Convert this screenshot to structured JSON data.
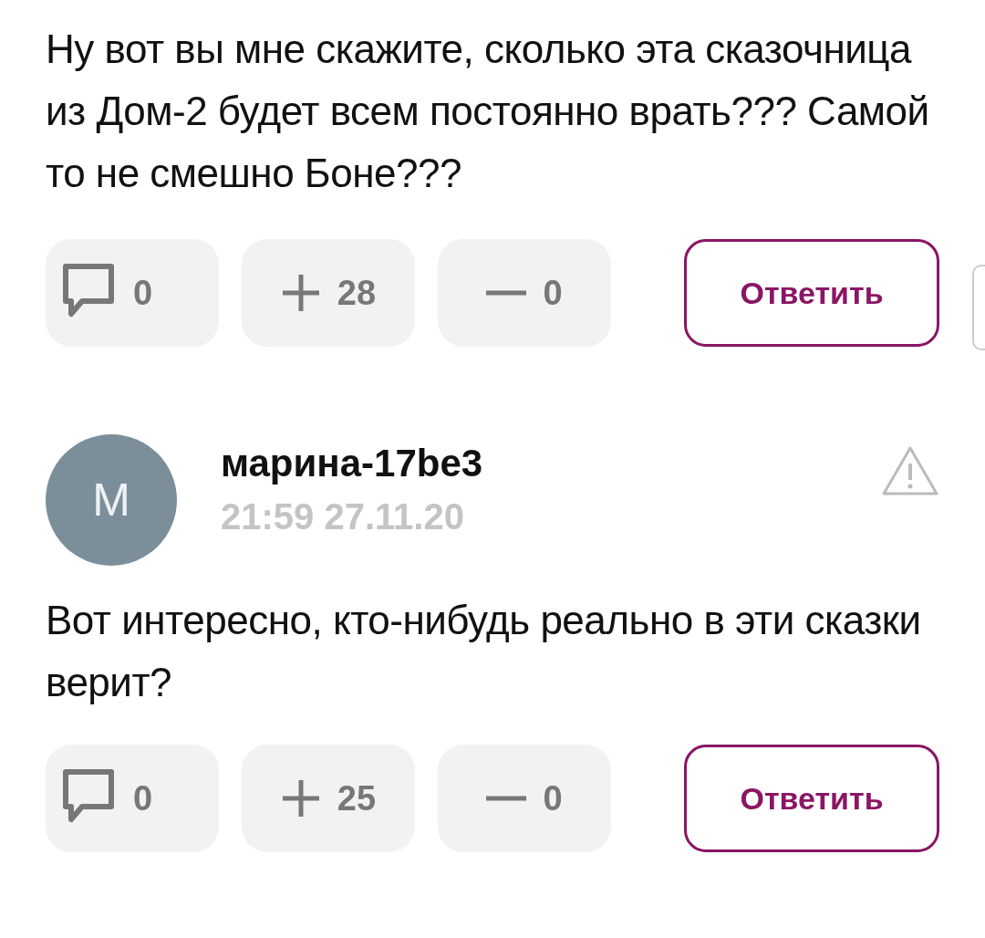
{
  "comments": [
    {
      "text": "Ну вот вы мне скажите, сколько эта сказочница из Дом-2 будет всем постоянно врать??? Самой то не смешно Боне???",
      "actions": {
        "replies": "0",
        "plus": "28",
        "minus": "0",
        "reply_label": "Ответить"
      }
    },
    {
      "author": {
        "initial": "M",
        "name": "марина-17be3",
        "time": "21:59 27.11.20"
      },
      "text": "Вот интересно, кто-нибудь реально в эти сказки верит?",
      "actions": {
        "replies": "0",
        "plus": "25",
        "minus": "0",
        "reply_label": "Ответить"
      }
    }
  ]
}
